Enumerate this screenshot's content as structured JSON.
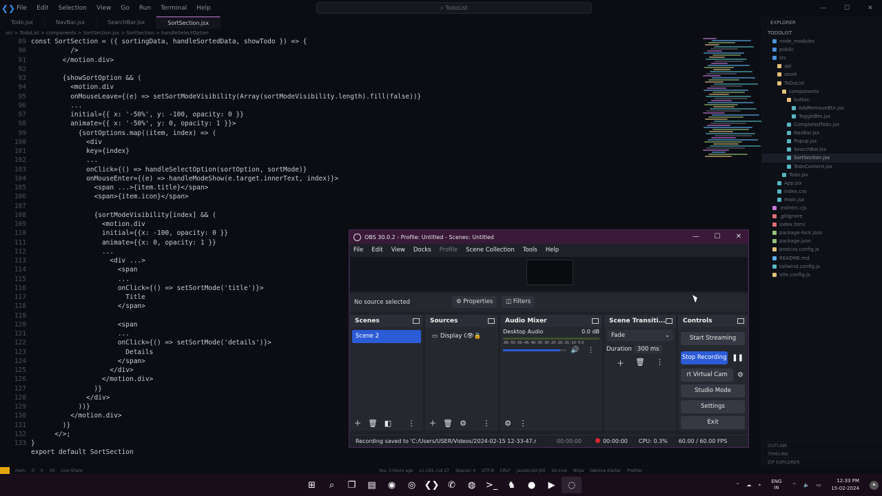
{
  "vscode": {
    "menu": [
      "File",
      "Edit",
      "Selection",
      "View",
      "Go",
      "Run",
      "Terminal",
      "Help"
    ],
    "search": "TodoList",
    "tabs": [
      "Todo.jsx",
      "NavBar.jsx",
      "SearchBar.jsx",
      "SortSection.jsx"
    ],
    "breadcrumb": "src > TodoList > components > SortSection.jsx > SortSection > handleSelectOption",
    "line_numbers": [
      "89",
      "90",
      "91",
      "92",
      "93",
      "94",
      "95",
      "96",
      "97",
      "98",
      "99",
      "100",
      "101",
      "102",
      "103",
      "104",
      "105",
      "106",
      "107",
      "108",
      "109",
      "110",
      "111",
      "112",
      "113",
      "114",
      "115",
      "116",
      "117",
      "118",
      "119",
      "120",
      "121",
      "122",
      "123",
      "124",
      "125",
      "126",
      "127",
      "128",
      "129",
      "130",
      "131",
      "132",
      "133"
    ],
    "code_lines": [
      "const SortSection = ({ sortingData, handleSortedData, showTodo }) => {",
      "          />",
      "        </motion.div>",
      "",
      "        {showSortOption && (",
      "          <motion.div",
      "          onMouseLeave={(e) => setSortModeVisibility(Array(sortModeVisibility.length).fill(false))}",
      "          ...",
      "          initial={{ x: '-50%', y: -100, opacity: 0 }}",
      "          animate={{ x: '-50%', y: 0, opacity: 1 }}>",
      "            {sortOptions.map((item, index) => (",
      "              <div",
      "              key={index}",
      "              ...",
      "              onClick={() => handleSelectOption(sortOption, sortMode)}",
      "              onMouseEnter={(e) => handleModeShow(e.target.innerText, index)}>",
      "                <span ...>{item.title}</span>",
      "                <span>{item.icon}</span>",
      "",
      "                {sortModeVisibility[index] && (",
      "                  <motion.div",
      "                  initial={{x: -100, opacity: 0 }}",
      "                  animate={{x: 0, opacity: 1 }}",
      "                  ...",
      "                    <div ...>",
      "                      <span",
      "                      ...",
      "                      onClick={() => setSortMode('title')}>",
      "                        Title",
      "                      </span>",
      "",
      "                      <span",
      "                      ...",
      "                      onClick={() => setSortMode('details')}>",
      "                        Details",
      "                      </span>",
      "                    </div>",
      "                  </motion.div>",
      "                )}",
      "              </div>",
      "            ))}",
      "          </motion.div>",
      "        )}",
      "      </>;",
      "}"
    ],
    "code_tail": "export default SortSection",
    "explorer_title": "EXPLORER",
    "explorer_root": "TODOLIST",
    "explorer_items": [
      {
        "name": "node_modules",
        "depth": 1,
        "color": "#4e8fd8"
      },
      {
        "name": "public",
        "depth": 1,
        "color": "#4e8fd8"
      },
      {
        "name": "src",
        "depth": 1,
        "color": "#4e8fd8"
      },
      {
        "name": "api",
        "depth": 2,
        "color": "#e5c07b"
      },
      {
        "name": "asset",
        "depth": 2,
        "color": "#e5c07b"
      },
      {
        "name": "ToDoList",
        "depth": 2,
        "color": "#e5c07b"
      },
      {
        "name": "components",
        "depth": 3,
        "color": "#e5c07b"
      },
      {
        "name": "button",
        "depth": 4,
        "color": "#e5c07b"
      },
      {
        "name": "AddRemoveBtn.jsx",
        "depth": 5,
        "color": "#56b6c2"
      },
      {
        "name": "ToggleBtn.jsx",
        "depth": 5,
        "color": "#56b6c2"
      },
      {
        "name": "CompletedTodo.jsx",
        "depth": 4,
        "color": "#56b6c2"
      },
      {
        "name": "NavBar.jsx",
        "depth": 4,
        "color": "#56b6c2"
      },
      {
        "name": "Popup.jsx",
        "depth": 4,
        "color": "#56b6c2"
      },
      {
        "name": "SearchBar.jsx",
        "depth": 4,
        "color": "#56b6c2"
      },
      {
        "name": "SortSection.jsx",
        "depth": 4,
        "color": "#56b6c2",
        "selected": true
      },
      {
        "name": "TodoContent.jsx",
        "depth": 4,
        "color": "#56b6c2"
      },
      {
        "name": "Todo.jsx",
        "depth": 3,
        "color": "#56b6c2"
      },
      {
        "name": "App.jsx",
        "depth": 2,
        "color": "#56b6c2"
      },
      {
        "name": "index.css",
        "depth": 2,
        "color": "#56b6c2"
      },
      {
        "name": "main.jsx",
        "depth": 2,
        "color": "#56b6c2"
      },
      {
        "name": ".eslintrc.cjs",
        "depth": 1,
        "color": "#c678dd"
      },
      {
        "name": ".gitignore",
        "depth": 1,
        "color": "#e06c75"
      },
      {
        "name": "index.html",
        "depth": 1,
        "color": "#e06c75"
      },
      {
        "name": "package-lock.json",
        "depth": 1,
        "color": "#98c379"
      },
      {
        "name": "package.json",
        "depth": 1,
        "color": "#98c379"
      },
      {
        "name": "postcss.config.js",
        "depth": 1,
        "color": "#e5c07b"
      },
      {
        "name": "README.md",
        "depth": 1,
        "color": "#61afef"
      },
      {
        "name": "tailwind.config.js",
        "depth": 1,
        "color": "#56b6c2"
      },
      {
        "name": "vite.config.js",
        "depth": 1,
        "color": "#e5c07b"
      }
    ],
    "explorer_footer": [
      "OUTLINE",
      "TIMELINE",
      "ZIP EXPLORER"
    ],
    "status_items": [
      "main",
      "0",
      "0",
      "34",
      "Live Share",
      "You, 3 hours ago",
      "Ln 103, Col 27",
      "Spaces: 4",
      "UTF-8",
      "CRLF",
      "JavaScript JSX",
      "Go Live",
      "Ninja",
      "tabnine starter",
      "Prettier"
    ]
  },
  "obs": {
    "title": "OBS 30.0.2 - Profile: Untitled - Scenes: Untitled",
    "menu": [
      "File",
      "Edit",
      "View",
      "Docks",
      "Profile",
      "Scene Collection",
      "Tools",
      "Help"
    ],
    "no_source": "No source selected",
    "properties": "Properties",
    "filters": "Filters",
    "docks": {
      "scenes": "Scenes",
      "sources": "Sources",
      "audio": "Audio Mixer",
      "transitions": "Scene Transiti...",
      "controls": "Controls"
    },
    "scene_items": [
      "Scene 2"
    ],
    "source_items": [
      "Display Ca"
    ],
    "audio": {
      "name": "Desktop Audio",
      "db": "0.0 dB",
      "scale": "-60 -55 -50 -45 -40 -35 -30 -25 -20 -15 -10 -5 0",
      "volume_fraction": 0.9
    },
    "transition": {
      "type": "Fade",
      "duration_label": "Duration",
      "duration": "300 ms"
    },
    "controls": [
      "Start Streaming",
      "Stop Recording",
      "rt Virtual Cam",
      "Studio Mode",
      "Settings",
      "Exit"
    ],
    "status": {
      "saved": "Recording saved to 'C:/Users/USER/Videos/2024-02-15 12-33-47.n",
      "stream_time": "00:00:00",
      "rec_time": "00:00:00",
      "cpu": "CPU: 0.3%",
      "fps": "60.00 / 60.00 FPS"
    }
  },
  "taskbar": {
    "apps": [
      "windows-start",
      "search",
      "task-view",
      "file-explorer",
      "edge",
      "chrome",
      "vscode",
      "whatsapp",
      "firefox",
      "terminal",
      "game",
      "app",
      "youtube",
      "obs"
    ],
    "lang": "ENG",
    "region": "IN",
    "time": "12:33 PM",
    "date": "15-02-2024"
  }
}
